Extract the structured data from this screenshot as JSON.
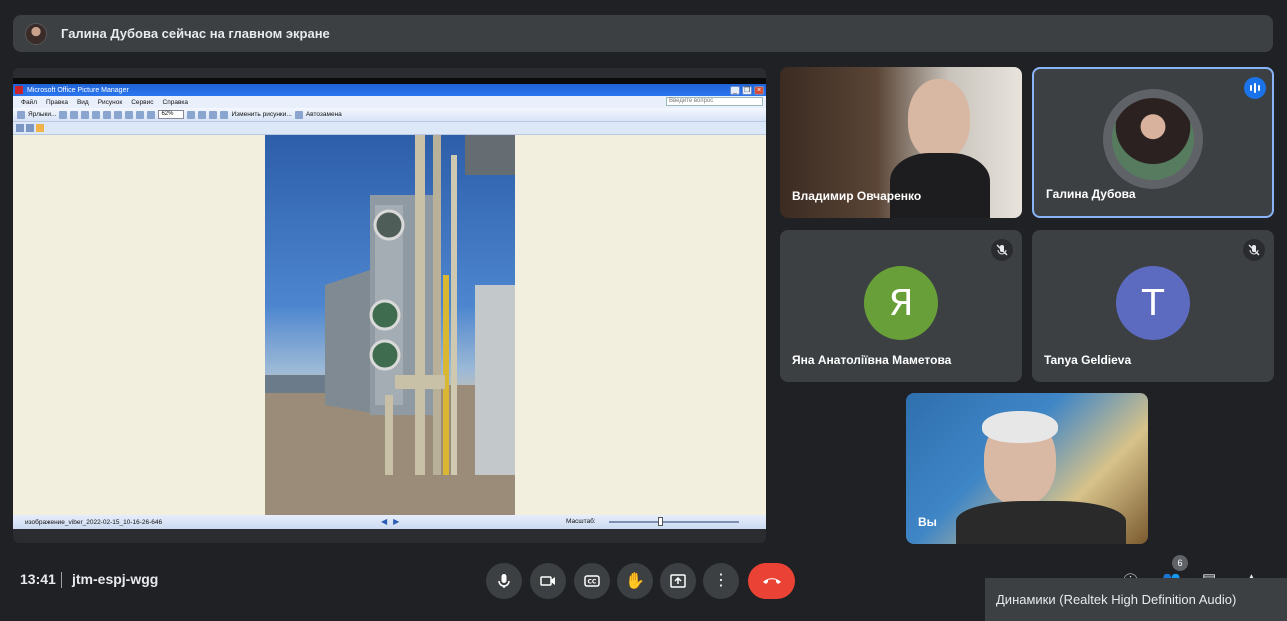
{
  "banner": {
    "text": "Галина Дубова сейчас на главном экране"
  },
  "shared_window": {
    "title": "Microsoft Office Picture Manager",
    "menu": [
      "Файл",
      "Правка",
      "Вид",
      "Рисунок",
      "Сервис",
      "Справка"
    ],
    "question_placeholder": "Введите вопрос",
    "toolbar": {
      "shortcuts_label": "Ярлыки...",
      "zoom": "62%",
      "edit_label": "Изменить рисунки...",
      "autocorrect_label": "Автозамена"
    },
    "status": {
      "filename": "изображение_viber_2022-02-15_10-16-26-646",
      "zoom_label": "Масштаб:"
    }
  },
  "participants": [
    {
      "name": "Владимир Овчаренко",
      "muted": false
    },
    {
      "name": "Галина Дубова",
      "speaking": true
    },
    {
      "name": "Яна Анатоліївна Маметова",
      "initial": "Я",
      "color": "#689f38",
      "muted": true
    },
    {
      "name": "Tanya Geldieva",
      "initial": "T",
      "color": "#5c6bc0",
      "muted": true
    },
    {
      "name": "Вы"
    }
  ],
  "bottom_bar": {
    "time": "13:41",
    "meeting_code": "jtm-espj-wgg",
    "participants_count": "6"
  },
  "tooltip": {
    "text": "Динамики (Realtek High Definition Audio)"
  }
}
